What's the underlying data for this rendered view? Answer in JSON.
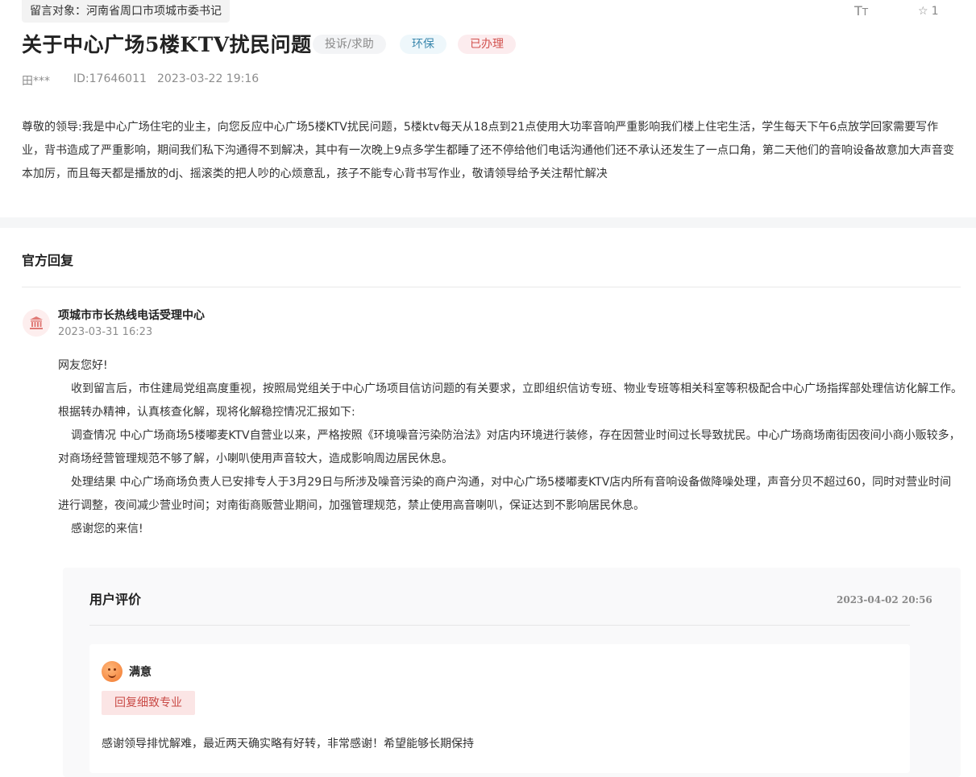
{
  "header": {
    "target_label": "留言对象：",
    "target_value": "河南省周口市项城市委书记",
    "font_size_icon": "text-size-icon",
    "favorite_icon": "star-icon",
    "favorite_count": "1"
  },
  "message": {
    "title": "关于中心广场5楼KTV扰民问题",
    "tags": {
      "type": "投诉/求助",
      "field": "环保",
      "status": "已办理"
    },
    "user": "田***",
    "id": "ID:17646011",
    "time": "2023-03-22 19:16",
    "content": "尊敬的领导:我是中心广场住宅的业主，向您反应中心广场5楼KTV扰民问题，5楼ktv每天从18点到21点使用大功率音响严重影响我们楼上住宅生活，学生每天下午6点放学回家需要写作业，背书造成了严重影响，期间我们私下沟通得不到解决，其中有一次晚上9点多学生都睡了还不停给他们电话沟通他们还不承认还发生了一点口角，第二天他们的音响设备故意加大声音变本加厉，而且每天都是播放的dj、摇滚类的把人吵的心烦意乱，孩子不能专心背书写作业，敬请领导给予关注帮忙解决"
  },
  "reply": {
    "section_title": "官方回复",
    "org_icon": "government-building-icon",
    "org_name": "项城市市长热线电话受理中心",
    "time": "2023-03-31 16:23",
    "paragraphs": [
      "网友您好!",
      "收到留言后，市住建局党组高度重视，按照局党组关于中心广场项目信访问题的有关要求，立即组织信访专班、物业专班等相关科室等积极配合中心广场指挥部处理信访化解工作。根据转办精神，认真核查化解，现将化解稳控情况汇报如下:",
      "调查情况  中心广场商场5楼嘟麦KTV自营业以来，严格按照《环境噪音污染防治法》对店内环境进行装修，存在因营业时间过长导致扰民。中心广场商场南街因夜间小商小贩较多，对商场经营管理规范不够了解，小喇叭使用声音较大，造成影响周边居民休息。",
      "处理结果  中心广场商场负责人已安排专人于3月29日与所涉及噪音污染的商户沟通，对中心广场5楼嘟麦KTV店内所有音响设备做降噪处理，声音分贝不超过60，同时对营业时间进行调整，夜间减少营业时间；对南街商贩营业期间，加强管理规范，禁止使用高音喇叭，保证达到不影响居民休息。",
      "感谢您的来信!"
    ]
  },
  "evaluation": {
    "title": "用户评价",
    "time": "2023-04-02 20:56",
    "satisfaction_icon": "smile-face-icon",
    "satisfaction": "满意",
    "tag": "回复细致专业",
    "comment": "感谢领导排忧解难，最近两天确实略有好转，非常感谢！希望能够长期保持"
  }
}
